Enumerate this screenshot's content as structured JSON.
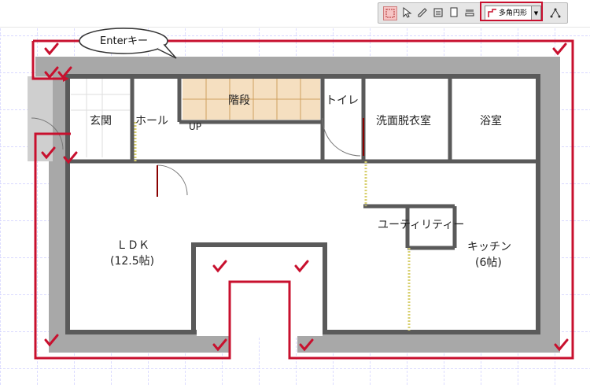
{
  "toolbar": {
    "buttons": [
      {
        "name": "select-rect-icon"
      },
      {
        "name": "pointer-icon"
      },
      {
        "name": "pen-icon"
      },
      {
        "name": "edit-icon"
      },
      {
        "name": "page-icon"
      },
      {
        "name": "layer-icon"
      }
    ],
    "shape_select": "多角円形",
    "last_button": {
      "name": "node-edit-icon"
    },
    "highlight_color": "#c8102e"
  },
  "callout": {
    "text": "Enterキー"
  },
  "plan": {
    "rooms": {
      "genkan": "玄関",
      "hall": "ホール",
      "stairs": "階段",
      "up": "UP",
      "toilet": "トイレ",
      "senmen": "洗面脱衣室",
      "yokushitsu": "浴室",
      "utility": "ユーティリティー",
      "ldk": "ＬＤＫ",
      "ldk_size": "(12.5帖)",
      "kitchen": "キッチン",
      "kitchen_size": "(6帖)"
    },
    "colors": {
      "outline": "#c8102e",
      "wall": "#a8a8a8",
      "grid": "#9a9aff"
    }
  }
}
